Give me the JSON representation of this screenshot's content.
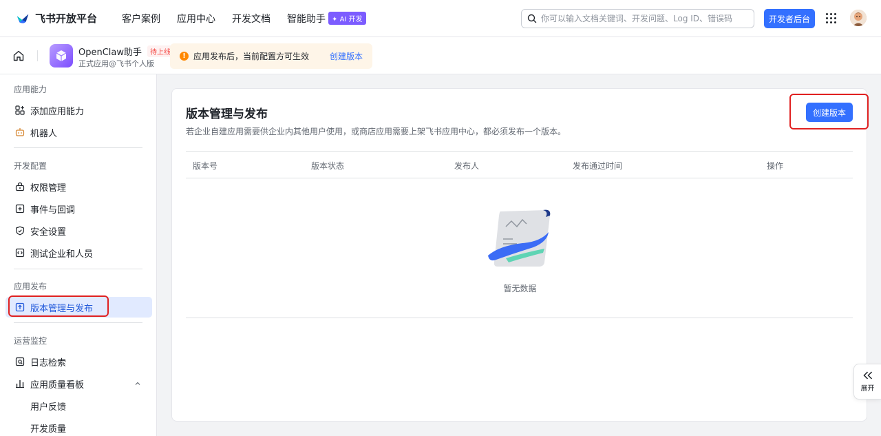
{
  "topnav": {
    "brand": "飞书开放平台",
    "links": [
      "客户案例",
      "应用中心",
      "开发文档",
      "智能助手"
    ],
    "ai_badge": "✦ AI 开发",
    "search_placeholder": "你可以输入文档关键词、开发问题、Log ID、错误码",
    "dev_console": "开发者后台"
  },
  "appbar": {
    "app_name": "OpenClaw助手",
    "status_tag": "待上线",
    "app_sub": "正式应用@飞书个人版",
    "notice_text": "应用发布后，当前配置方可生效",
    "notice_link": "创建版本"
  },
  "sidebar": {
    "sections": [
      {
        "title": "应用能力",
        "items": [
          "添加应用能力",
          "机器人"
        ]
      },
      {
        "title": "开发配置",
        "items": [
          "权限管理",
          "事件与回调",
          "安全设置",
          "测试企业和人员"
        ]
      },
      {
        "title": "应用发布",
        "items": [
          "版本管理与发布"
        ]
      },
      {
        "title": "运营监控",
        "items": [
          "日志检索",
          "应用质量看板",
          "用户反馈",
          "开发质量"
        ]
      }
    ]
  },
  "main": {
    "title": "版本管理与发布",
    "description": "若企业自建应用需要供企业内其他用户使用，或商店应用需要上架飞书应用中心，都必须发布一个版本。",
    "create_button": "创建版本",
    "columns": [
      "版本号",
      "版本状态",
      "发布人",
      "发布通过时间",
      "操作"
    ],
    "empty_text": "暂无数据"
  },
  "expand": {
    "label": "展开"
  },
  "colors": {
    "primary": "#3370ff",
    "highlight": "#e02020",
    "active_bg": "#e1eaff"
  }
}
